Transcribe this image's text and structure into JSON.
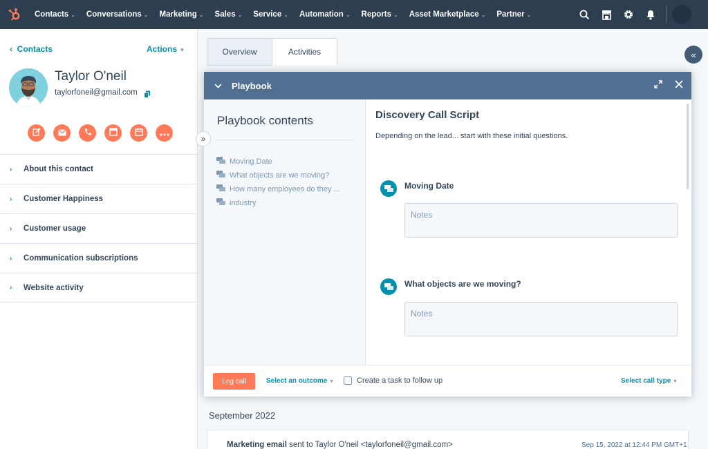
{
  "nav": {
    "items": [
      "Contacts",
      "Conversations",
      "Marketing",
      "Sales",
      "Service",
      "Automation",
      "Reports",
      "Asset Marketplace",
      "Partner"
    ],
    "brand_color": "#ff7a59",
    "icons": [
      "search-icon",
      "marketplace-icon",
      "gear-icon",
      "bell-icon",
      "avatar"
    ]
  },
  "sidebar": {
    "back_label": "Contacts",
    "actions_label": "Actions",
    "contact": {
      "name": "Taylor O'neil",
      "email": "taylorfoneil@gmail.com"
    },
    "actions": [
      "note-icon",
      "email-icon",
      "phone-icon",
      "task-icon",
      "calendar-icon",
      "more-icon"
    ],
    "sections": [
      "About this contact",
      "Customer Happiness",
      "Customer usage",
      "Communication subscriptions",
      "Website activity"
    ]
  },
  "main": {
    "tabs": [
      "Overview",
      "Activities"
    ],
    "month_label": "September 2022",
    "email_entry": {
      "type": "Marketing email",
      "text": "sent to Taylor O'neil <taylorfoneil@gmail.com>",
      "date": "Sep 15, 2022 at 12:44 PM GMT+1"
    }
  },
  "playbook": {
    "title": "Playbook",
    "contents_title": "Playbook contents",
    "contents_items": [
      "Moving Date",
      "What objects are we moving?",
      "How many employees do they ...",
      "industry"
    ],
    "script_title": "Discovery Call Script",
    "script_desc": "Depending on the lead... start with these initial questions.",
    "questions": [
      {
        "text": "Moving Date",
        "placeholder": "Notes"
      },
      {
        "text": "What objects are we moving?",
        "placeholder": "Notes"
      }
    ],
    "footer": {
      "log_label": "Log call",
      "outcome_label": "Select an outcome",
      "task_label": "Create a task to follow up",
      "call_type_label": "Select call type"
    }
  }
}
